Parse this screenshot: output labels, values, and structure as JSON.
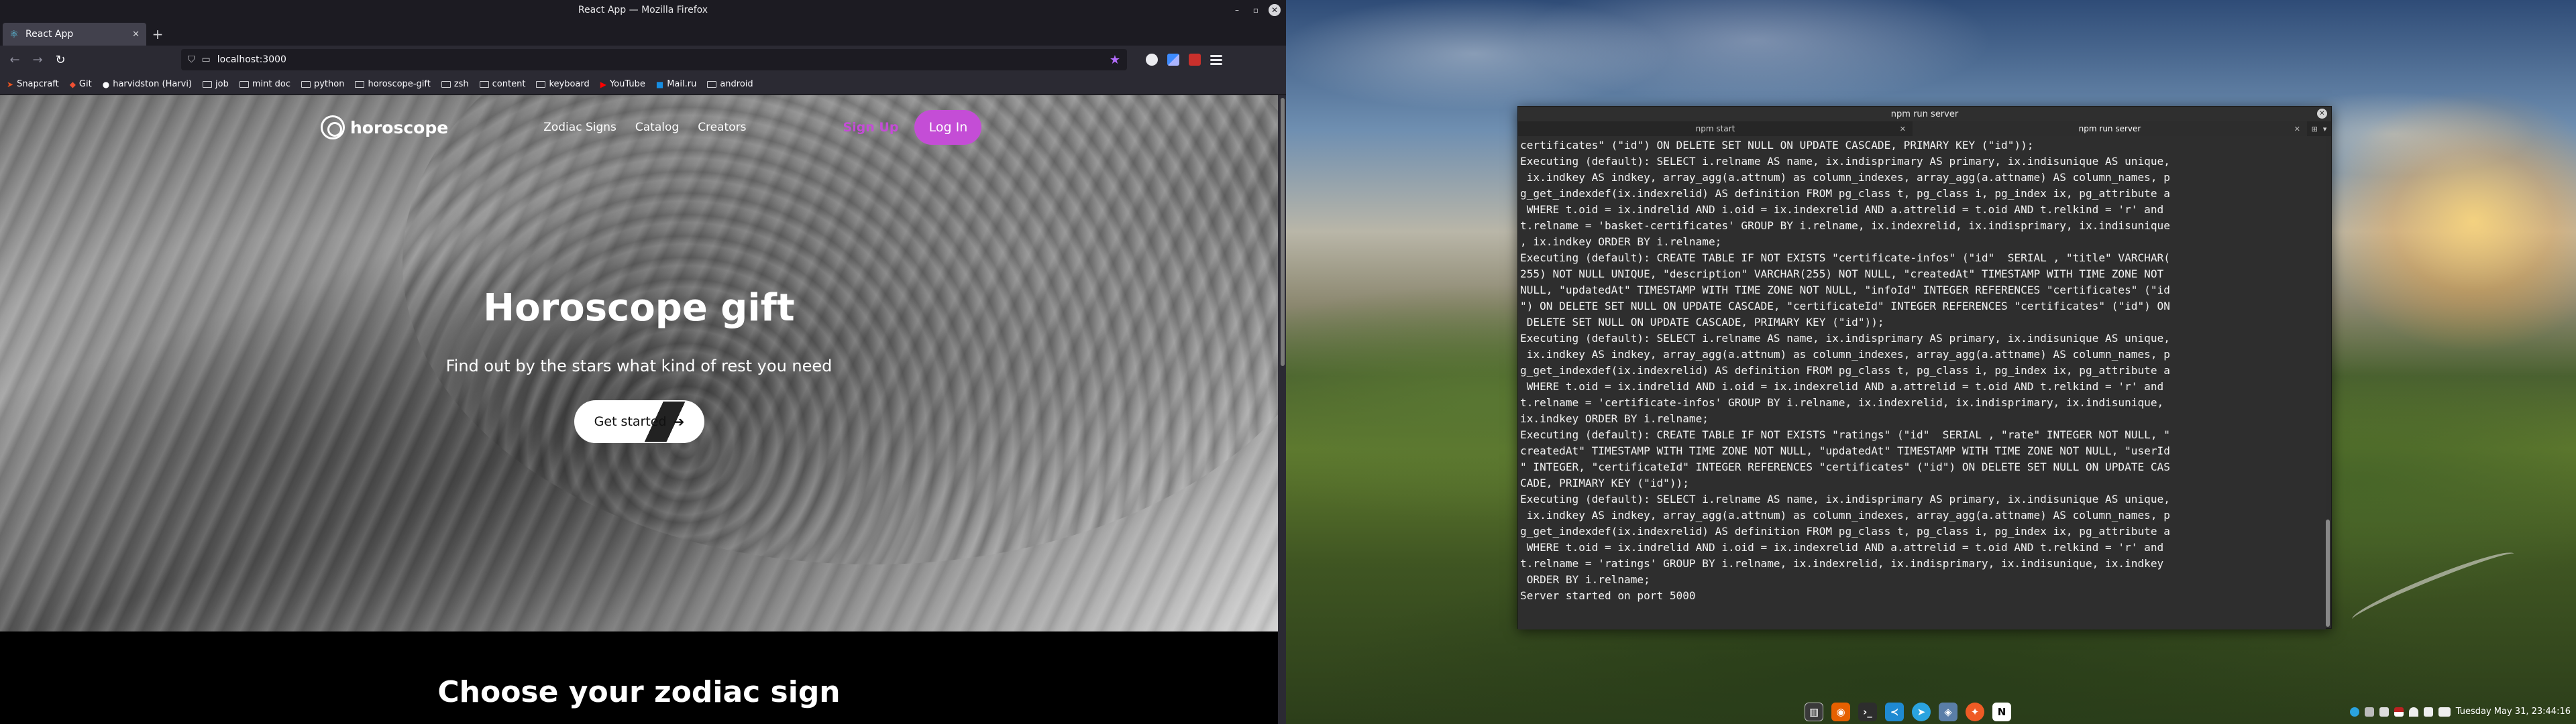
{
  "firefox": {
    "window_title": "React App — Mozilla Firefox",
    "tab": {
      "title": "React App"
    },
    "url": "localhost:3000",
    "bookmarks": [
      {
        "label": "Snapcraft",
        "icon": "snapcraft-icon"
      },
      {
        "label": "Git",
        "icon": "git-icon"
      },
      {
        "label": "harvidston (Harvi)",
        "icon": "github-icon"
      },
      {
        "label": "job",
        "icon": "folder-icon"
      },
      {
        "label": "mint doc",
        "icon": "folder-icon"
      },
      {
        "label": "python",
        "icon": "folder-icon"
      },
      {
        "label": "horoscope-gift",
        "icon": "folder-icon"
      },
      {
        "label": "zsh",
        "icon": "folder-icon"
      },
      {
        "label": "content",
        "icon": "folder-icon"
      },
      {
        "label": "keyboard",
        "icon": "folder-icon"
      },
      {
        "label": "YouTube",
        "icon": "youtube-icon"
      },
      {
        "label": "Mail.ru",
        "icon": "mailru-icon"
      },
      {
        "label": "android",
        "icon": "folder-icon"
      }
    ]
  },
  "site": {
    "logo": "horoscope",
    "nav": [
      "Zodiac Signs",
      "Catalog",
      "Creators"
    ],
    "signup": "Sign Up",
    "login": "Log In",
    "hero_title": "Horoscope gift",
    "hero_subtitle": "Find out by the stars what kind of rest you need",
    "cta": "Get started",
    "zodiac_heading": "Choose your zodiac sign",
    "accent_color": "#c44dd6"
  },
  "terminal": {
    "window_title": "npm run server",
    "tabs": [
      "npm start",
      "npm run server"
    ],
    "lines": [
      "certificates\" (\"id\") ON DELETE SET NULL ON UPDATE CASCADE, PRIMARY KEY (\"id\"));",
      "Executing (default): SELECT i.relname AS name, ix.indisprimary AS primary, ix.indisunique AS unique,",
      " ix.indkey AS indkey, array_agg(a.attnum) as column_indexes, array_agg(a.attname) AS column_names, p",
      "g_get_indexdef(ix.indexrelid) AS definition FROM pg_class t, pg_class i, pg_index ix, pg_attribute a",
      " WHERE t.oid = ix.indrelid AND i.oid = ix.indexrelid AND a.attrelid = t.oid AND t.relkind = 'r' and",
      "t.relname = 'basket-certificates' GROUP BY i.relname, ix.indexrelid, ix.indisprimary, ix.indisunique",
      ", ix.indkey ORDER BY i.relname;",
      "Executing (default): CREATE TABLE IF NOT EXISTS \"certificate-infos\" (\"id\"  SERIAL , \"title\" VARCHAR(",
      "255) NOT NULL UNIQUE, \"description\" VARCHAR(255) NOT NULL, \"createdAt\" TIMESTAMP WITH TIME ZONE NOT",
      "NULL, \"updatedAt\" TIMESTAMP WITH TIME ZONE NOT NULL, \"infoId\" INTEGER REFERENCES \"certificates\" (\"id",
      "\") ON DELETE SET NULL ON UPDATE CASCADE, \"certificateId\" INTEGER REFERENCES \"certificates\" (\"id\") ON",
      " DELETE SET NULL ON UPDATE CASCADE, PRIMARY KEY (\"id\"));",
      "Executing (default): SELECT i.relname AS name, ix.indisprimary AS primary, ix.indisunique AS unique,",
      " ix.indkey AS indkey, array_agg(a.attnum) as column_indexes, array_agg(a.attname) AS column_names, p",
      "g_get_indexdef(ix.indexrelid) AS definition FROM pg_class t, pg_class i, pg_index ix, pg_attribute a",
      " WHERE t.oid = ix.indrelid AND i.oid = ix.indexrelid AND a.attrelid = t.oid AND t.relkind = 'r' and",
      "t.relname = 'certificate-infos' GROUP BY i.relname, ix.indexrelid, ix.indisprimary, ix.indisunique,",
      "ix.indkey ORDER BY i.relname;",
      "Executing (default): CREATE TABLE IF NOT EXISTS \"ratings\" (\"id\"  SERIAL , \"rate\" INTEGER NOT NULL, \"",
      "createdAt\" TIMESTAMP WITH TIME ZONE NOT NULL, \"updatedAt\" TIMESTAMP WITH TIME ZONE NOT NULL, \"userId",
      "\" INTEGER, \"certificateId\" INTEGER REFERENCES \"certificates\" (\"id\") ON DELETE SET NULL ON UPDATE CAS",
      "CADE, PRIMARY KEY (\"id\"));",
      "Executing (default): SELECT i.relname AS name, ix.indisprimary AS primary, ix.indisunique AS unique,",
      " ix.indkey AS indkey, array_agg(a.attnum) as column_indexes, array_agg(a.attname) AS column_names, p",
      "g_get_indexdef(ix.indexrelid) AS definition FROM pg_class t, pg_class i, pg_index ix, pg_attribute a",
      " WHERE t.oid = ix.indrelid AND i.oid = ix.indexrelid AND a.attrelid = t.oid AND t.relkind = 'r' and",
      "t.relname = 'ratings' GROUP BY i.relname, ix.indexrelid, ix.indisprimary, ix.indisunique, ix.indkey",
      " ORDER BY i.relname;",
      "Server started on port 5000"
    ]
  },
  "taskbar": {
    "apps": [
      {
        "icon": "tiling-icon",
        "color": "#3a3a3a"
      },
      {
        "icon": "firefox-icon",
        "color": "#e66000"
      },
      {
        "icon": "terminal-icon",
        "color": "#2d2d2d"
      },
      {
        "icon": "vscode-icon",
        "color": "#1f8ad2"
      },
      {
        "icon": "telegram-icon",
        "color": "#2aa3df"
      },
      {
        "icon": "dbeaver-icon",
        "color": "#5a7ea8"
      },
      {
        "icon": "postman-icon",
        "color": "#ef5b25"
      },
      {
        "icon": "notion-icon",
        "color": "#ffffff"
      }
    ],
    "clock": "Tuesday May 31, 23:44:16"
  }
}
